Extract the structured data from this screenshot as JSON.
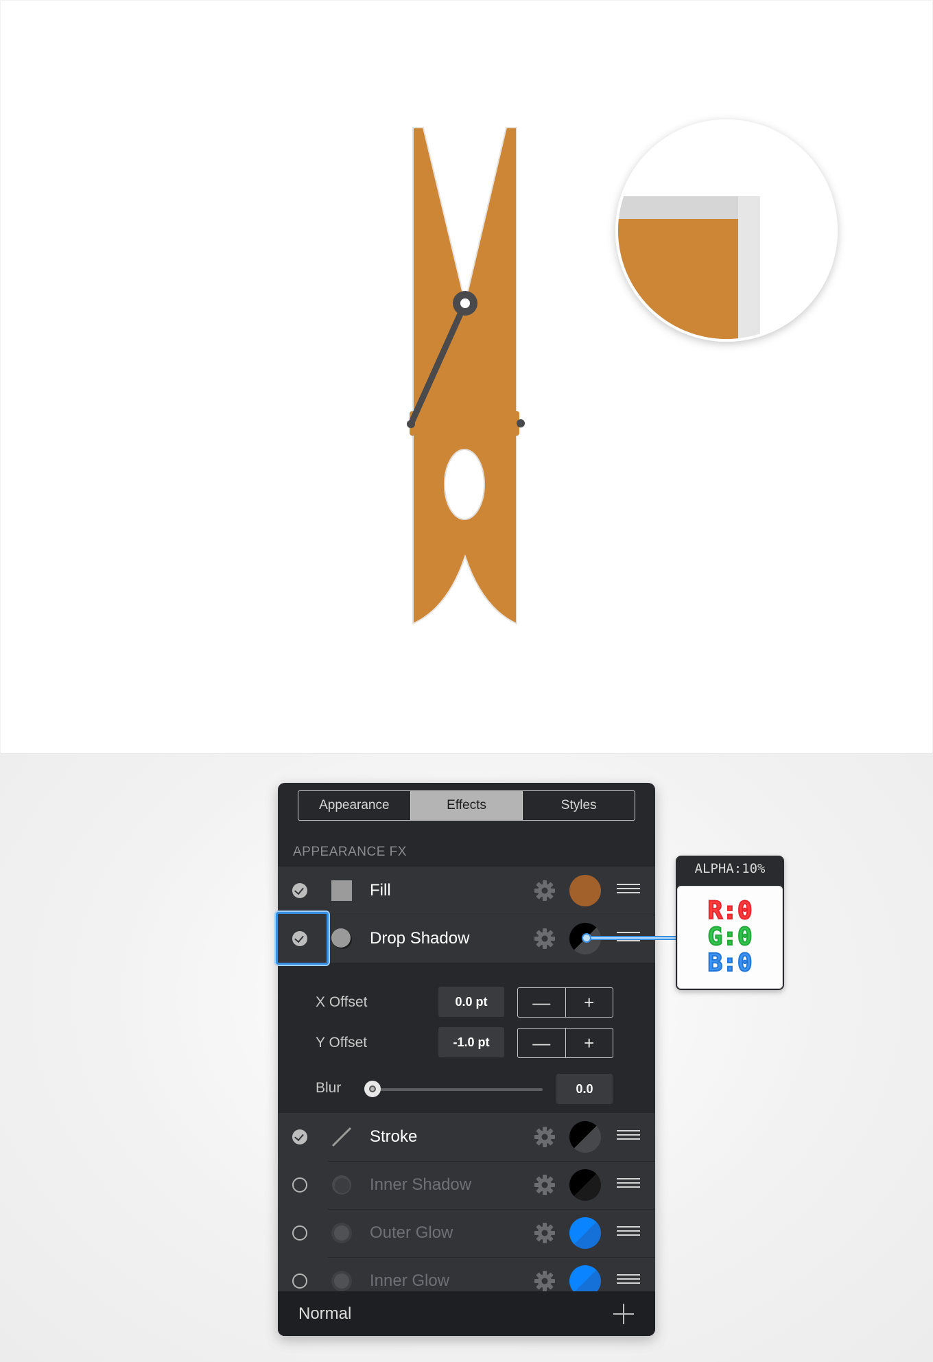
{
  "colors": {
    "clothespin": "#cd8636",
    "fill_swatch": "#a2602a",
    "accent_blue": "#0a84ff",
    "panel_bg": "#27282b"
  },
  "panel": {
    "tabs": [
      {
        "label": "Appearance",
        "active": false
      },
      {
        "label": "Effects",
        "active": true
      },
      {
        "label": "Styles",
        "active": false
      }
    ],
    "section_label": "APPEARANCE FX",
    "effects": [
      {
        "label": "Fill",
        "enabled": true,
        "icon": "square-fill-icon",
        "swatch": "#a2602a"
      },
      {
        "label": "Drop Shadow",
        "enabled": true,
        "icon": "shadow-circle-icon",
        "swatch": "black-split"
      },
      {
        "label": "Stroke",
        "enabled": true,
        "icon": "stroke-line-icon",
        "swatch": "black-split"
      },
      {
        "label": "Inner Shadow",
        "enabled": false,
        "icon": "shadow-circle-icon",
        "swatch": "black-split"
      },
      {
        "label": "Outer Glow",
        "enabled": false,
        "icon": "glow-circle-icon",
        "swatch": "#0a84ff"
      },
      {
        "label": "Inner Glow",
        "enabled": false,
        "icon": "glow-circle-icon",
        "swatch": "#0a84ff"
      }
    ],
    "drop_shadow_settings": {
      "x_offset_label": "X Offset",
      "x_offset_value": "0.0 pt",
      "y_offset_label": "Y Offset",
      "y_offset_value": "-1.0 pt",
      "blur_label": "Blur",
      "blur_value": "0.0",
      "minus": "—",
      "plus": "+"
    },
    "footer": {
      "blend_mode": "Normal"
    }
  },
  "callout": {
    "alpha": "ALPHA:10%",
    "r": "R:0",
    "g": "G:0",
    "b": "B:0"
  }
}
